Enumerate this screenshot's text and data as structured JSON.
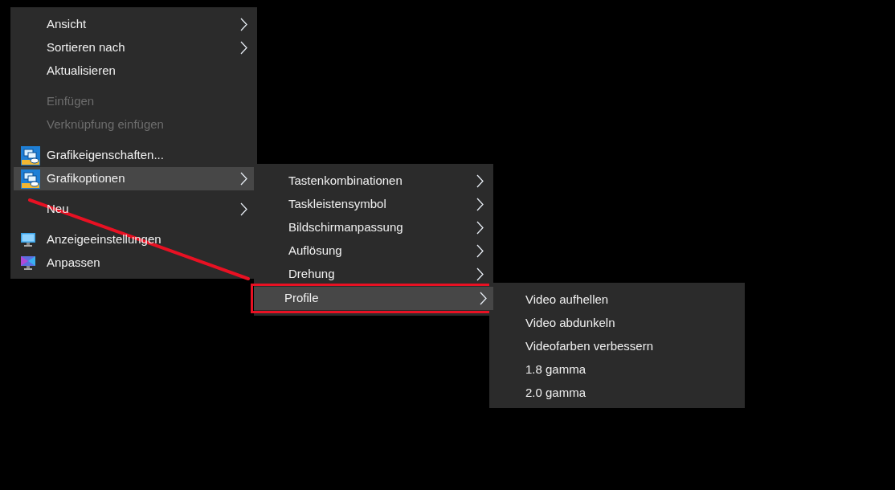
{
  "menus": [
    {
      "items": [
        {
          "kind": "item",
          "label": "Ansicht",
          "submenu": true,
          "disabled": false,
          "selected": false
        },
        {
          "kind": "item",
          "label": "Sortieren nach",
          "submenu": true,
          "disabled": false,
          "selected": false
        },
        {
          "kind": "item",
          "label": "Aktualisieren",
          "submenu": false,
          "disabled": false,
          "selected": false
        },
        {
          "kind": "separator"
        },
        {
          "kind": "item",
          "label": "Einfügen",
          "submenu": false,
          "disabled": true,
          "selected": false
        },
        {
          "kind": "item",
          "label": "Verknüpfung einfügen",
          "submenu": false,
          "disabled": true,
          "selected": false
        },
        {
          "kind": "separator"
        },
        {
          "kind": "graphics",
          "label": "Grafikeigenschaften...",
          "submenu": false,
          "disabled": false,
          "selected": false
        },
        {
          "kind": "graphics",
          "label": "Grafikoptionen",
          "submenu": true,
          "disabled": false,
          "selected": true
        },
        {
          "kind": "separator"
        },
        {
          "kind": "item",
          "label": "Neu",
          "submenu": true,
          "disabled": false,
          "selected": false
        },
        {
          "kind": "separator"
        },
        {
          "kind": "display",
          "label": "Anzeigeeinstellungen",
          "submenu": false,
          "disabled": false,
          "selected": false
        },
        {
          "kind": "personalize",
          "label": "Anpassen",
          "submenu": false,
          "disabled": false,
          "selected": false
        }
      ]
    },
    {
      "items": [
        {
          "kind": "item",
          "label": "Tastenkombinationen",
          "submenu": true,
          "disabled": false,
          "selected": false
        },
        {
          "kind": "item",
          "label": "Taskleistensymbol",
          "submenu": true,
          "disabled": false,
          "selected": false
        },
        {
          "kind": "item",
          "label": "Bildschirmanpassung",
          "submenu": true,
          "disabled": false,
          "selected": false
        },
        {
          "kind": "item",
          "label": "Auflösung",
          "submenu": true,
          "disabled": false,
          "selected": false
        },
        {
          "kind": "item",
          "label": "Drehung",
          "submenu": true,
          "disabled": false,
          "selected": false
        },
        {
          "kind": "item",
          "label": "Profile",
          "submenu": true,
          "disabled": false,
          "selected": true,
          "highlighted": true
        }
      ]
    },
    {
      "items": [
        {
          "kind": "item",
          "label": "Video aufhellen",
          "submenu": false,
          "disabled": false,
          "selected": false
        },
        {
          "kind": "item",
          "label": "Video abdunkeln",
          "submenu": false,
          "disabled": false,
          "selected": false
        },
        {
          "kind": "item",
          "label": "Videofarben verbessern",
          "submenu": false,
          "disabled": false,
          "selected": false
        },
        {
          "kind": "item",
          "label": "1.8 gamma",
          "submenu": false,
          "disabled": false,
          "selected": false
        },
        {
          "kind": "item",
          "label": "2.0 gamma",
          "submenu": false,
          "disabled": false,
          "selected": false
        }
      ]
    }
  ]
}
